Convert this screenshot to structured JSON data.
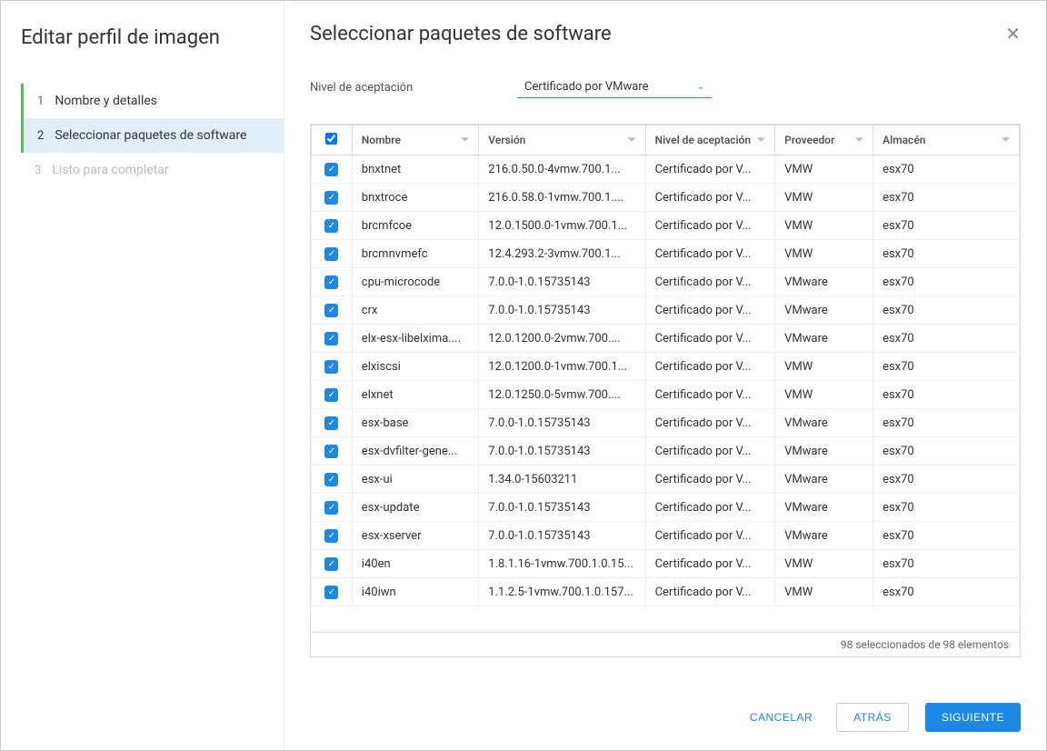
{
  "sidebar": {
    "title": "Editar perfil de imagen",
    "steps": [
      {
        "num": "1",
        "label": "Nombre y detalles",
        "state": "completed"
      },
      {
        "num": "2",
        "label": "Seleccionar paquetes de software",
        "state": "active"
      },
      {
        "num": "3",
        "label": "Listo para completar",
        "state": "disabled"
      }
    ]
  },
  "main": {
    "title": "Seleccionar paquetes de software",
    "filter_label": "Nivel de aceptación",
    "filter_value": "Certificado por VMware",
    "columns": {
      "name": "Nombre",
      "version": "Versión",
      "acceptance": "Nivel de aceptación",
      "vendor": "Proveedor",
      "store": "Almacén"
    },
    "rows": [
      {
        "name": "bnxtnet",
        "version": "216.0.50.0-4vmw.700.1...",
        "acc": "Certificado por V...",
        "vendor": "VMW",
        "store": "esx70"
      },
      {
        "name": "bnxtroce",
        "version": "216.0.58.0-1vmw.700.1....",
        "acc": "Certificado por V...",
        "vendor": "VMW",
        "store": "esx70"
      },
      {
        "name": "brcmfcoe",
        "version": "12.0.1500.0-1vmw.700.1...",
        "acc": "Certificado por V...",
        "vendor": "VMW",
        "store": "esx70"
      },
      {
        "name": "brcmnvmefc",
        "version": "12.4.293.2-3vmw.700.1...",
        "acc": "Certificado por V...",
        "vendor": "VMW",
        "store": "esx70"
      },
      {
        "name": "cpu-microcode",
        "version": "7.0.0-1.0.15735143",
        "acc": "Certificado por V...",
        "vendor": "VMware",
        "store": "esx70"
      },
      {
        "name": "crx",
        "version": "7.0.0-1.0.15735143",
        "acc": "Certificado por V...",
        "vendor": "VMware",
        "store": "esx70"
      },
      {
        "name": "elx-esx-libelxima....",
        "version": "12.0.1200.0-2vmw.700....",
        "acc": "Certificado por V...",
        "vendor": "VMware",
        "store": "esx70"
      },
      {
        "name": "elxiscsi",
        "version": "12.0.1200.0-1vmw.700.1...",
        "acc": "Certificado por V...",
        "vendor": "VMW",
        "store": "esx70"
      },
      {
        "name": "elxnet",
        "version": "12.0.1250.0-5vmw.700....",
        "acc": "Certificado por V...",
        "vendor": "VMW",
        "store": "esx70"
      },
      {
        "name": "esx-base",
        "version": "7.0.0-1.0.15735143",
        "acc": "Certificado por V...",
        "vendor": "VMware",
        "store": "esx70"
      },
      {
        "name": "esx-dvfilter-gene...",
        "version": "7.0.0-1.0.15735143",
        "acc": "Certificado por V...",
        "vendor": "VMware",
        "store": "esx70"
      },
      {
        "name": "esx-ui",
        "version": "1.34.0-15603211",
        "acc": "Certificado por V...",
        "vendor": "VMware",
        "store": "esx70"
      },
      {
        "name": "esx-update",
        "version": "7.0.0-1.0.15735143",
        "acc": "Certificado por V...",
        "vendor": "VMware",
        "store": "esx70"
      },
      {
        "name": "esx-xserver",
        "version": "7.0.0-1.0.15735143",
        "acc": "Certificado por V...",
        "vendor": "VMware",
        "store": "esx70"
      },
      {
        "name": "i40en",
        "version": "1.8.1.16-1vmw.700.1.0.15...",
        "acc": "Certificado por V...",
        "vendor": "VMW",
        "store": "esx70"
      },
      {
        "name": "i40iwn",
        "version": "1.1.2.5-1vmw.700.1.0.157...",
        "acc": "Certificado por V...",
        "vendor": "VMW",
        "store": "esx70"
      }
    ],
    "footer_text": "98 seleccionados de 98 elementos"
  },
  "buttons": {
    "cancel": "CANCELAR",
    "back": "ATRÁS",
    "next": "SIGUIENTE"
  }
}
